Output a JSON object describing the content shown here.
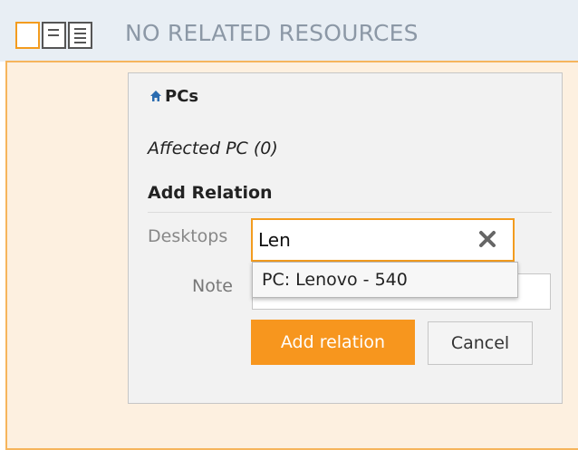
{
  "toolbar": {
    "view_icons": [
      "single-column-view-icon",
      "text-view-icon",
      "list-view-icon"
    ],
    "title": "NO RELATED RESOURCES"
  },
  "panel": {
    "home_icon": "home-icon",
    "title": "PCs",
    "affected_label": "Affected PC (0)",
    "add_relation_heading": "Add Relation",
    "desktops_label": "Desktops",
    "search_value": "Len",
    "clear_icon": "close-icon",
    "suggestion": "PC: Lenovo - 540",
    "note_label": "Note",
    "note_value": "",
    "add_button_label": "Add relation",
    "cancel_button_label": "Cancel"
  },
  "colors": {
    "accent": "#f7961e",
    "topbar_bg": "#e8eef4",
    "area_bg": "#fdf0e0",
    "panel_bg": "#f2f2f2"
  }
}
